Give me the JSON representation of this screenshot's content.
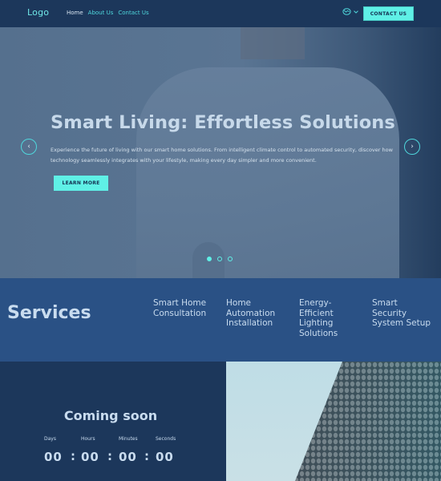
{
  "header": {
    "logo": "Logo",
    "nav": [
      {
        "label": "Home",
        "active": true
      },
      {
        "label": "About Us",
        "active": false
      },
      {
        "label": "Contact Us",
        "active": false
      }
    ],
    "language_icon": "globe-language-icon",
    "contact_button": "CONTACT US"
  },
  "hero": {
    "title": "Smart Living: Effortless Solutions",
    "text": "Experience the future of living with our smart home solutions. From intelligent climate control to automated security, discover how technology seamlessly integrates with your lifestyle, making every day simpler and more convenient.",
    "cta": "LEARN MORE",
    "prev_icon": "‹",
    "next_icon": "›",
    "slides_total": 3,
    "active_slide": 1
  },
  "services": {
    "title": "Services",
    "items": [
      "Smart Home Consultation",
      "Home Automation Installation",
      "Energy-Efficient Lighting Solutions",
      "Smart Security System Setup"
    ],
    "items_lines": [
      [
        "Smart Home",
        "Consultation"
      ],
      [
        "Home",
        "Automation",
        "Installation"
      ],
      [
        "Energy-",
        "Efficient",
        "Lighting",
        "Solutions"
      ],
      [
        "Smart",
        "Security",
        "System Setup"
      ]
    ]
  },
  "countdown": {
    "title": "Coming soon",
    "labels": [
      "Days",
      "Hours",
      "Minutes",
      "Seconds"
    ],
    "values": [
      "00",
      "00",
      "00",
      "00"
    ],
    "separator": ":"
  },
  "colors": {
    "accent": "#5ff0e6",
    "navy": "#1c375b",
    "services_bg": "#2a5185",
    "text_light": "#c9dcef"
  }
}
